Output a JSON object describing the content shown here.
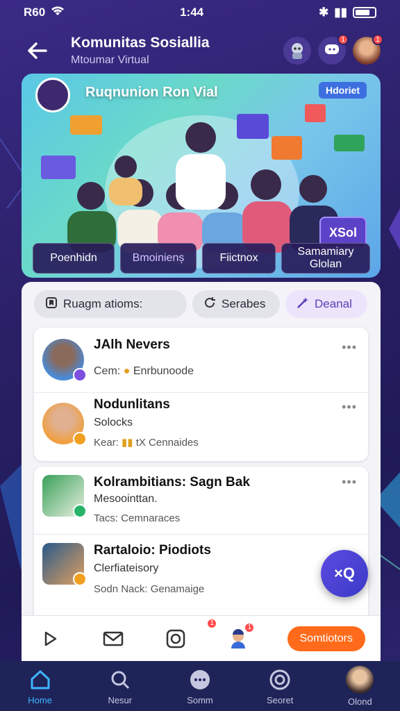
{
  "status_bar": {
    "left": "R60",
    "time": "1:44"
  },
  "header": {
    "title": "Komunitas Sosiallia",
    "subtitle": "Mtoumar Virtual",
    "notif_count": "1"
  },
  "banner": {
    "title": "Ruqnunion Ron Vial",
    "badge": "Hdoriet",
    "xsol_label": "XSol",
    "actions": [
      "Poenhidn",
      "Bmoinienș",
      "Fiictnox",
      "Samamiary Glolan"
    ]
  },
  "chips": [
    {
      "label": "Ruagm atioms:",
      "icon": "bookmark-icon"
    },
    {
      "label": "Serabes",
      "icon": "refresh-icon"
    },
    {
      "label": "Deanal",
      "icon": "wand-icon"
    }
  ],
  "card1": [
    {
      "name": "JAlh Nevers",
      "sub": "Cem:",
      "sub2": "Enrbunoode",
      "accent": "#7b4fe0"
    },
    {
      "name": "Nodunlitans",
      "sub": "Solocks",
      "sub2": "",
      "meta": "Kear:",
      "meta2": "tX Cennaides",
      "accent": "#f0a020"
    }
  ],
  "card2": [
    {
      "name": "Kolrambitians: Sagn Bak",
      "sub": "Mesoointtan.",
      "meta": "Tacs: Cemnaraces",
      "accent": "#29b36a"
    },
    {
      "name": "Rartaloio: Piodiots",
      "sub": "Clerfiateisory",
      "meta": "Sodn Nack: Genamaige",
      "accent": "#f0a020"
    }
  ],
  "fab_label": "×Q",
  "toolbar": {
    "button_label": "Somtiotors",
    "notif_count": "1"
  },
  "bottom_nav": [
    {
      "label": "Home",
      "icon": "home-icon"
    },
    {
      "label": "Nesur",
      "icon": "search-icon"
    },
    {
      "label": "Somm",
      "icon": "chat-icon"
    },
    {
      "label": "Seoret",
      "icon": "explore-icon"
    },
    {
      "label": "Olond",
      "icon": "profile-avatar"
    }
  ],
  "colors": {
    "accent": "#3fb4ff",
    "orange": "#ff6b1a",
    "purple": "#5b43c7"
  }
}
